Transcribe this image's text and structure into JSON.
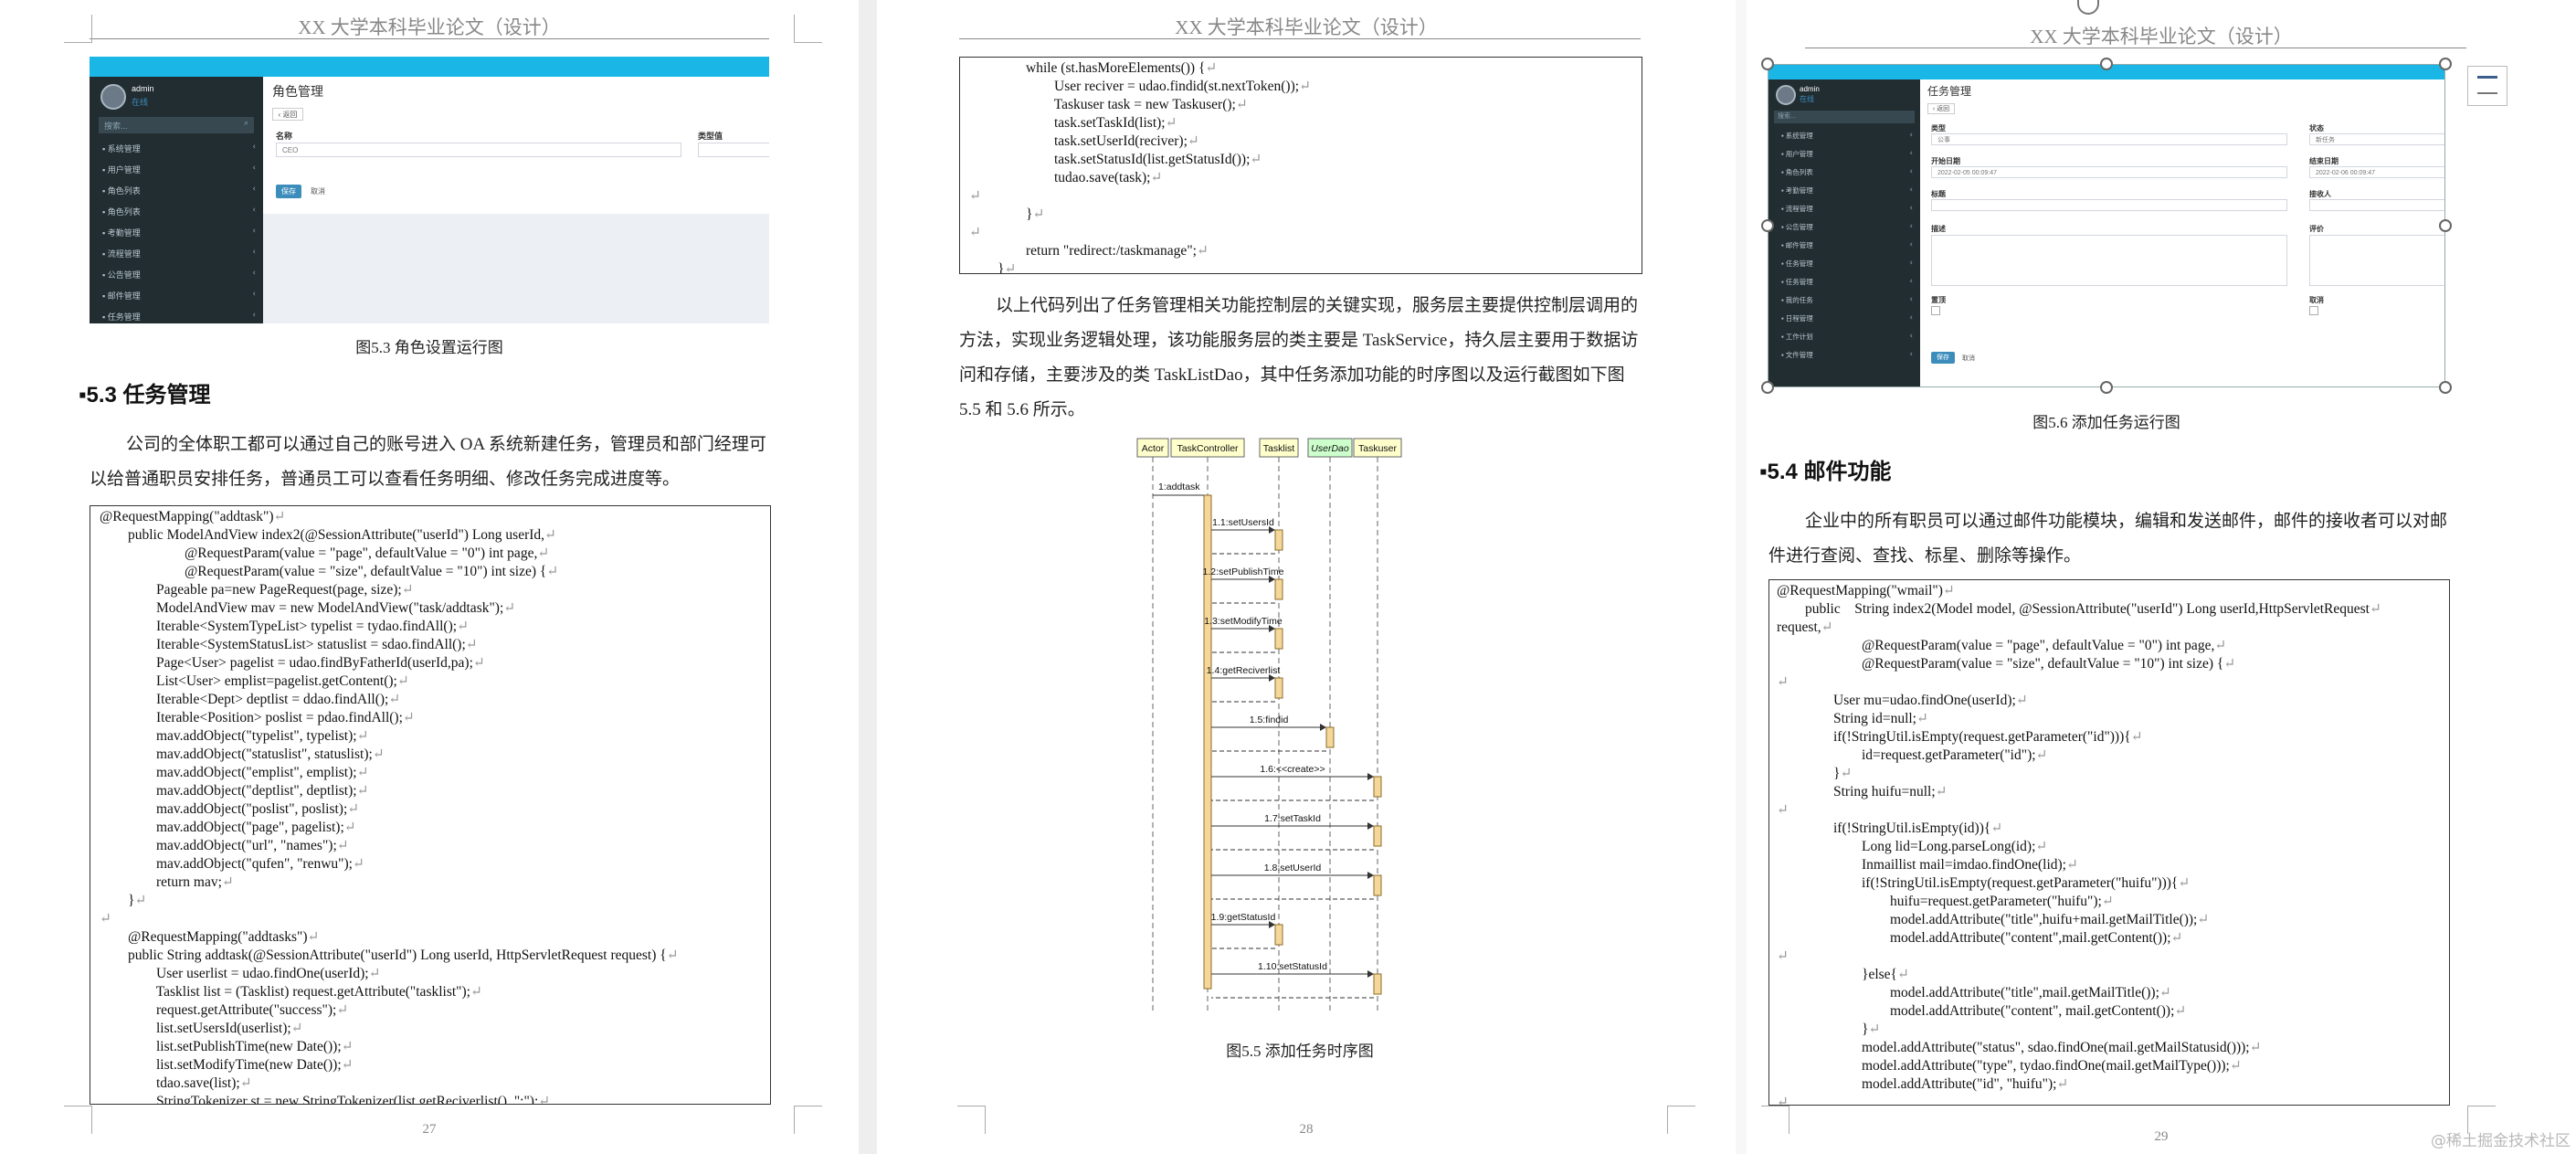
{
  "header": "XX 大学本科毕业论文（设计）",
  "watermark": "@稀土掘金技术社区",
  "page27": {
    "page_number": "27",
    "figure_caption": "图5.3  角色设置运行图",
    "section_title": "5.3  任务管理",
    "paragraph": "公司的全体职工都可以通过自己的账号进入 OA 系统新建任务，管理员和部门经理可以给普通职员安排任务，普通员工可以查看任务明细、修改任务完成进度等。",
    "shot": {
      "user_name": "admin",
      "user_status": "在线",
      "search_placeholder": "搜索...",
      "page_title": "角色管理",
      "back_button": "返回",
      "field1_label": "名称",
      "field1_value": "CEO",
      "field2_label": "类型值",
      "save_button": "保存",
      "cancel_button": "取消",
      "menu": [
        "系统管理",
        "用户管理",
        "角色列表",
        "角色列表",
        "考勤管理",
        "流程管理",
        "公告管理",
        "邮件管理",
        "任务管理"
      ]
    },
    "code": [
      "@RequestMapping(\"addtask\")",
      "        public ModelAndView index2(@SessionAttribute(\"userId\") Long userId,",
      "                        @RequestParam(value = \"page\", defaultValue = \"0\") int page,",
      "                        @RequestParam(value = \"size\", defaultValue = \"10\") int size) {",
      "                Pageable pa=new PageRequest(page, size);",
      "                ModelAndView mav = new ModelAndView(\"task/addtask\");",
      "                Iterable<SystemTypeList> typelist = tydao.findAll();",
      "                Iterable<SystemStatusList> statuslist = sdao.findAll();",
      "                Page<User> pagelist = udao.findByFatherId(userId,pa);",
      "                List<User> emplist=pagelist.getContent();",
      "                Iterable<Dept> deptlist = ddao.findAll();",
      "                Iterable<Position> poslist = pdao.findAll();",
      "                mav.addObject(\"typelist\", typelist);",
      "                mav.addObject(\"statuslist\", statuslist);",
      "                mav.addObject(\"emplist\", emplist);",
      "                mav.addObject(\"deptlist\", deptlist);",
      "                mav.addObject(\"poslist\", poslist);",
      "                mav.addObject(\"page\", pagelist);",
      "                mav.addObject(\"url\", \"names\");",
      "                mav.addObject(\"qufen\", \"renwu\");",
      "                return mav;",
      "        }",
      "",
      "        @RequestMapping(\"addtasks\")",
      "        public String addtask(@SessionAttribute(\"userId\") Long userId, HttpServletRequest request) {",
      "                User userlist = udao.findOne(userId);",
      "                Tasklist list = (Tasklist) request.getAttribute(\"tasklist\");",
      "                request.getAttribute(\"success\");",
      "                list.setUsersId(userlist);",
      "                list.setPublishTime(new Date());",
      "                list.setModifyTime(new Date());",
      "                tdao.save(list);",
      "                StringTokenizer st = new StringTokenizer(list.getReciverlist(), \";\");"
    ]
  },
  "page28": {
    "page_number": "28",
    "code": [
      "                while (st.hasMoreElements()) {",
      "                        User reciver = udao.findid(st.nextToken());",
      "                        Taskuser task = new Taskuser();",
      "                        task.setTaskId(list);",
      "                        task.setUserId(reciver);",
      "                        task.setStatusId(list.getStatusId());",
      "                        tudao.save(task);",
      "",
      "                }",
      "",
      "                return \"redirect:/taskmanage\";",
      "        }"
    ],
    "paragraph": "以上代码列出了任务管理相关功能控制层的关键实现，服务层主要提供控制层调用的方法，实现业务逻辑处理，该功能服务层的类主要是 TaskService，持久层主要用于数据访问和存储，主要涉及的类 TaskListDao，其中任务添加功能的时序图以及运行截图如下图 5.5 和 5.6 所示。",
    "figure_caption": "图5.5  添加任务时序图",
    "diagram": {
      "participants": [
        "Actor",
        "TaskController",
        "Tasklist",
        "UserDao",
        "Taskuser"
      ],
      "messages": [
        "1:addtask",
        "1.1:setUsersId",
        "1.2:setPublishTime",
        "1.3:setModifyTime",
        "1.4:getReciverlist",
        "1.5:findid",
        "1.6:<<create>>",
        "1.7:setTaskId",
        "1.8:setUserId",
        "1.9:getStatusId",
        "1.10:setStatusId"
      ]
    }
  },
  "page29": {
    "page_number": "29",
    "figure_caption": "图5.6  添加任务运行图",
    "section_title": "5.4  邮件功能",
    "paragraph": "企业中的所有职员可以通过邮件功能模块，编辑和发送邮件，邮件的接收者可以对邮件进行查阅、查找、标星、删除等操作。",
    "shot": {
      "page_title": "任务管理",
      "back_button": "返回",
      "labels": [
        "类型",
        "状态",
        "开始日期",
        "结束日期",
        "标题",
        "接收人",
        "描述",
        "评价",
        "置顶",
        "取消"
      ],
      "type_value": "公事",
      "status_value": "新任务",
      "start_date": "2022-02-05 00:09:47",
      "end_date": "2022-02-06 00:09:47",
      "save_button": "保存",
      "cancel_button": "取消",
      "menu": [
        "系统管理",
        "用户管理",
        "角色列表",
        "考勤管理",
        "流程管理",
        "公告管理",
        "邮件管理",
        "任务管理",
        "任务管理",
        "我的任务",
        "日程管理",
        "工作计划",
        "文件管理"
      ]
    },
    "code": [
      "@RequestMapping(\"wmail\")",
      "        public    String index2(Model model, @SessionAttribute(\"userId\") Long userId,HttpServletRequest",
      "request,",
      "                        @RequestParam(value = \"page\", defaultValue = \"0\") int page,",
      "                        @RequestParam(value = \"size\", defaultValue = \"10\") int size) {",
      "",
      "                User mu=udao.findOne(userId);",
      "                String id=null;",
      "                if(!StringUtil.isEmpty(request.getParameter(\"id\"))){",
      "                        id=request.getParameter(\"id\");",
      "                }",
      "                String huifu=null;",
      "",
      "                if(!StringUtil.isEmpty(id)){",
      "                        Long lid=Long.parseLong(id);",
      "                        Inmaillist mail=imdao.findOne(lid);",
      "                        if(!StringUtil.isEmpty(request.getParameter(\"huifu\"))){",
      "                                huifu=request.getParameter(\"huifu\");",
      "                                model.addAttribute(\"title\",huifu+mail.getMailTitle());",
      "                                model.addAttribute(\"content\",mail.getContent());",
      "",
      "                        }else{",
      "                                model.addAttribute(\"title\",mail.getMailTitle());",
      "                                model.addAttribute(\"content\", mail.getContent());",
      "                        }",
      "                        model.addAttribute(\"status\", sdao.findOne(mail.getMailStatusid()));",
      "                        model.addAttribute(\"type\", tydao.findOne(mail.getMailType()));",
      "                        model.addAttribute(\"id\", \"huifu\");",
      ""
    ]
  }
}
